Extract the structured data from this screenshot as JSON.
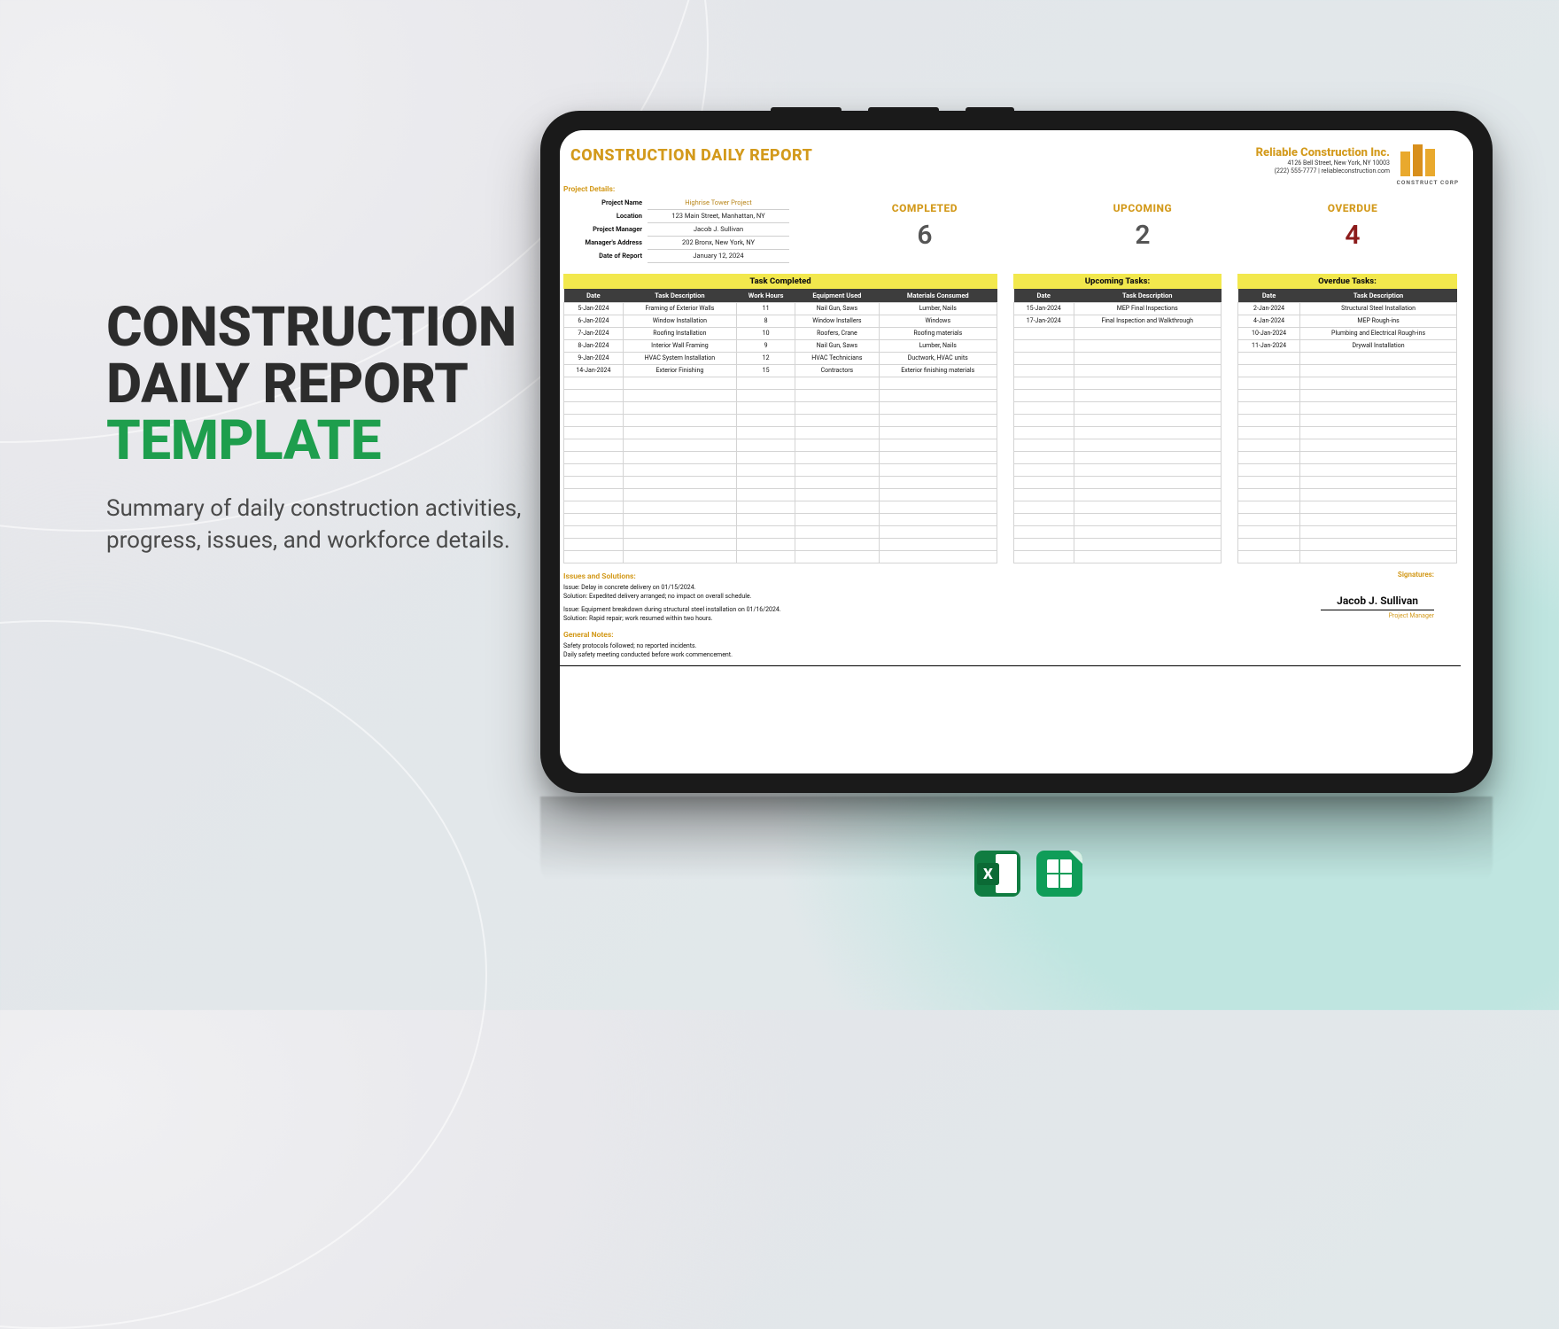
{
  "hero": {
    "title_line1": "CONSTRUCTION",
    "title_line2": "DAILY REPORT",
    "title_line3": "TEMPLATE",
    "subtitle": "Summary of daily construction activities, progress, issues, and workforce details."
  },
  "formats": {
    "excel": "Excel",
    "sheets": "Google Sheets"
  },
  "doc": {
    "title": "CONSTRUCTION DAILY REPORT",
    "company": {
      "name": "Reliable Construction Inc.",
      "addr": "4126 Bell Street, New York, NY 10003",
      "contact": "(222) 555-7777 | reliableconstruction.com",
      "logo_label": "CONSTRUCT CORP"
    },
    "project_details_label": "Project Details:",
    "details": [
      {
        "label": "Project Name",
        "value": "Highrise Tower Project",
        "accent": true
      },
      {
        "label": "Location",
        "value": "123 Main Street, Manhattan, NY"
      },
      {
        "label": "Project Manager",
        "value": "Jacob J. Sullivan"
      },
      {
        "label": "Manager's Address",
        "value": "202 Bronx, New York, NY"
      },
      {
        "label": "Date of Report",
        "value": "January 12, 2024"
      }
    ],
    "stats": {
      "completed": {
        "label": "COMPLETED",
        "value": "6"
      },
      "upcoming": {
        "label": "UPCOMING",
        "value": "2"
      },
      "overdue": {
        "label": "OVERDUE",
        "value": "4"
      }
    },
    "tables": {
      "completed": {
        "caption": "Task Completed",
        "headers": [
          "Date",
          "Task Description",
          "Work Hours",
          "Equipment Used",
          "Materials Consumed"
        ],
        "rows": [
          [
            "5-Jan-2024",
            "Framing of Exterior Walls",
            "11",
            "Nail Gun, Saws",
            "Lumber, Nails"
          ],
          [
            "6-Jan-2024",
            "Window Installation",
            "8",
            "Window Installers",
            "Windows"
          ],
          [
            "7-Jan-2024",
            "Roofing Installation",
            "10",
            "Roofers, Crane",
            "Roofing materials"
          ],
          [
            "8-Jan-2024",
            "Interior Wall Framing",
            "9",
            "Nail Gun, Saws",
            "Lumber, Nails"
          ],
          [
            "9-Jan-2024",
            "HVAC System Installation",
            "12",
            "HVAC Technicians",
            "Ductwork, HVAC units"
          ],
          [
            "14-Jan-2024",
            "Exterior Finishing",
            "15",
            "Contractors",
            "Exterior finishing materials"
          ]
        ],
        "blank_rows": 15
      },
      "upcoming": {
        "caption": "Upcoming Tasks:",
        "headers": [
          "Date",
          "Task Description"
        ],
        "rows": [
          [
            "15-Jan-2024",
            "MEP Final Inspections"
          ],
          [
            "17-Jan-2024",
            "Final Inspection and Walkthrough"
          ]
        ],
        "blank_rows": 19
      },
      "overdue": {
        "caption": "Overdue Tasks:",
        "headers": [
          "Date",
          "Task Description"
        ],
        "rows": [
          [
            "2-Jan-2024",
            "Structural Steel Installation"
          ],
          [
            "4-Jan-2024",
            "MEP Rough-ins"
          ],
          [
            "10-Jan-2024",
            "Plumbing and Electrical Rough-ins"
          ],
          [
            "11-Jan-2024",
            "Drywall Installation"
          ]
        ],
        "blank_rows": 17
      }
    },
    "issues_label": "Issues and Solutions:",
    "issues": [
      {
        "issue": "Issue: Delay in concrete delivery on 01/15/2024.",
        "solution": "Solution: Expedited delivery arranged; no impact on overall schedule."
      },
      {
        "issue": "Issue: Equipment breakdown during structural steel installation on 01/16/2024.",
        "solution": "Solution: Rapid repair; work resumed within two hours."
      }
    ],
    "notes_label": "General Notes:",
    "notes": [
      "Safety protocols followed; no reported incidents.",
      "Daily safety meeting conducted before work commencement."
    ],
    "signature": {
      "label": "Signatures:",
      "name": "Jacob J. Sullivan",
      "role": "Project Manager"
    }
  }
}
